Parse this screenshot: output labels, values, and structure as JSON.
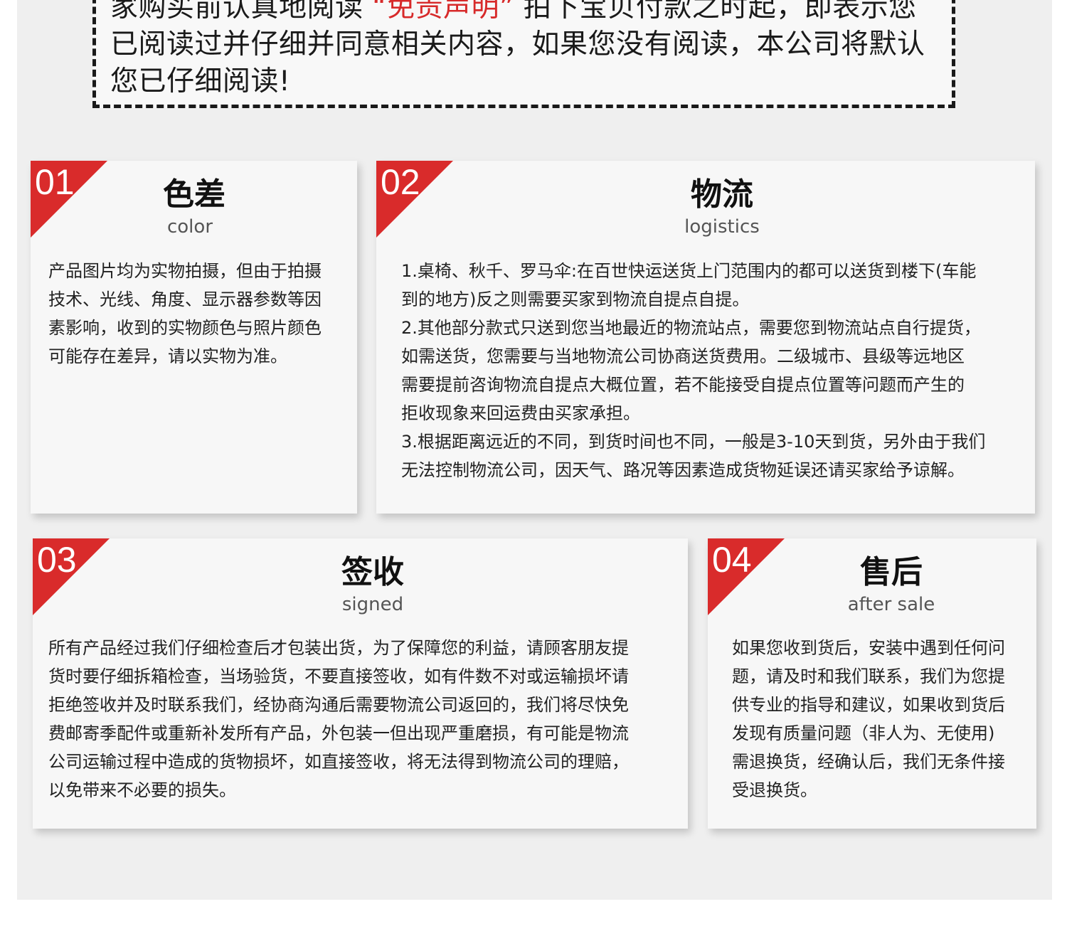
{
  "notice": {
    "line1_a": "家购买前认真地阅读",
    "line1_red": "“免责声明”",
    "line1_b": "拍下宝贝付款之时起，即表示您",
    "line2": "已阅读过并仔细并同意相关内容，如果您没有阅读，本公司将默认",
    "line3": "您已仔细阅读!"
  },
  "cards": [
    {
      "num": "01",
      "title": "色差",
      "subtitle": "color",
      "lines": [
        "产品图片均为实物拍摄，但由于拍摄",
        "技术、光线、角度、显示器参数等因",
        "素影响，收到的实物颜色与照片颜色",
        "可能存在差异，请以实物为准。"
      ]
    },
    {
      "num": "02",
      "title": "物流",
      "subtitle": "logistics",
      "lines": [
        "1.桌椅、秋千、罗马伞:在百世快运送货上门范围内的都可以送货到楼下(车能",
        "到的地方)反之则需要买家到物流自提点自提。",
        "2.其他部分款式只送到您当地最近的物流站点，需要您到物流站点自行提货，",
        "如需送货，您需要与当地物流公司协商送货费用。二级城市、县级等远地区",
        "需要提前咨询物流自提点大概位置，若不能接受自提点位置等问题而产生的",
        "拒收现象来回运费由买家承担。",
        "3.根据距离远近的不同，到货时间也不同，一般是3-10天到货，另外由于我们",
        "无法控制物流公司，因天气、路况等因素造成货物延误还请买家给予谅解。"
      ]
    },
    {
      "num": "03",
      "title": "签收",
      "subtitle": "signed",
      "lines": [
        "所有产品经过我们仔细检查后才包装出货，为了保障您的利益，请顾客朋友提",
        "货时要仔细拆箱检查，当场验货，不要直接签收，如有件数不对或运输损坏请",
        "拒绝签收并及时联系我们，经协商沟通后需要物流公司返回的，我们将尽快免",
        "费邮寄季配件或重新补发所有产品，外包装一但出现严重磨损，有可能是物流",
        "公司运输过程中造成的货物损坏，如直接签收，将无法得到物流公司的理赔，",
        "以免带来不必要的损失。"
      ]
    },
    {
      "num": "04",
      "title": "售后",
      "subtitle": "after sale",
      "lines": [
        "如果您收到货后，安装中遇到任何问",
        "题，请及时和我们联系，我们为您提",
        "供专业的指导和建议，如果收到货后",
        "发现有质量问题（非人为、无使用)",
        "需退换货，经确认后，我们无条件接",
        "受退换货。"
      ]
    }
  ],
  "colors": {
    "accent_red": "#d92b2b",
    "panel_bg": "#efefef",
    "card_bg": "#f7f7f7"
  }
}
